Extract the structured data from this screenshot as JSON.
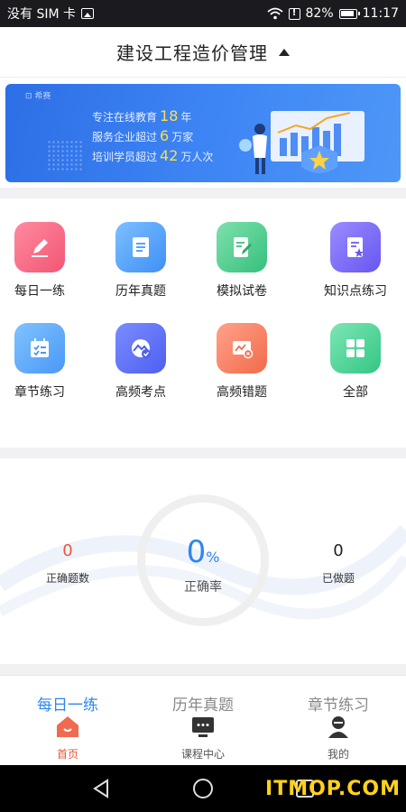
{
  "status": {
    "carrier": "没有 SIM 卡",
    "battery": "82%",
    "time": "11:17"
  },
  "header": {
    "title": "建设工程造价管理"
  },
  "banner": {
    "tag": "⊡ 希赛",
    "line1_pre": "专注在线教育",
    "line1_num": "18",
    "line1_post": "年",
    "line2_pre": "服务企业超过",
    "line2_num": "6",
    "line2_post": "万家",
    "line3_pre": "培训学员超过",
    "line3_num": "42",
    "line3_post": "万人次"
  },
  "features": [
    {
      "label": "每日一练",
      "icon": "pencil-icon"
    },
    {
      "label": "历年真题",
      "icon": "document-icon"
    },
    {
      "label": "模拟试卷",
      "icon": "edit-paper-icon"
    },
    {
      "label": "知识点练习",
      "icon": "star-document-icon"
    },
    {
      "label": "章节练习",
      "icon": "checklist-icon"
    },
    {
      "label": "高频考点",
      "icon": "mountain-check-icon"
    },
    {
      "label": "高频错题",
      "icon": "error-chart-icon"
    },
    {
      "label": "全部",
      "icon": "grid-icon"
    }
  ],
  "stats": {
    "correct_count": "0",
    "correct_count_label": "正确题数",
    "rate": "0",
    "rate_unit": "%",
    "rate_label": "正确率",
    "done": "0",
    "done_label": "已做题"
  },
  "tabs": [
    "每日一练",
    "历年真题",
    "章节练习"
  ],
  "nav": [
    {
      "label": "首页",
      "icon": "home-icon"
    },
    {
      "label": "课程中心",
      "icon": "course-icon"
    },
    {
      "label": "我的",
      "icon": "user-icon"
    }
  ],
  "watermark": "ITMOP.COM",
  "colors": {
    "accent": "#2e86f0",
    "home_active": "#e8563c",
    "banner": "#3b80f0"
  }
}
